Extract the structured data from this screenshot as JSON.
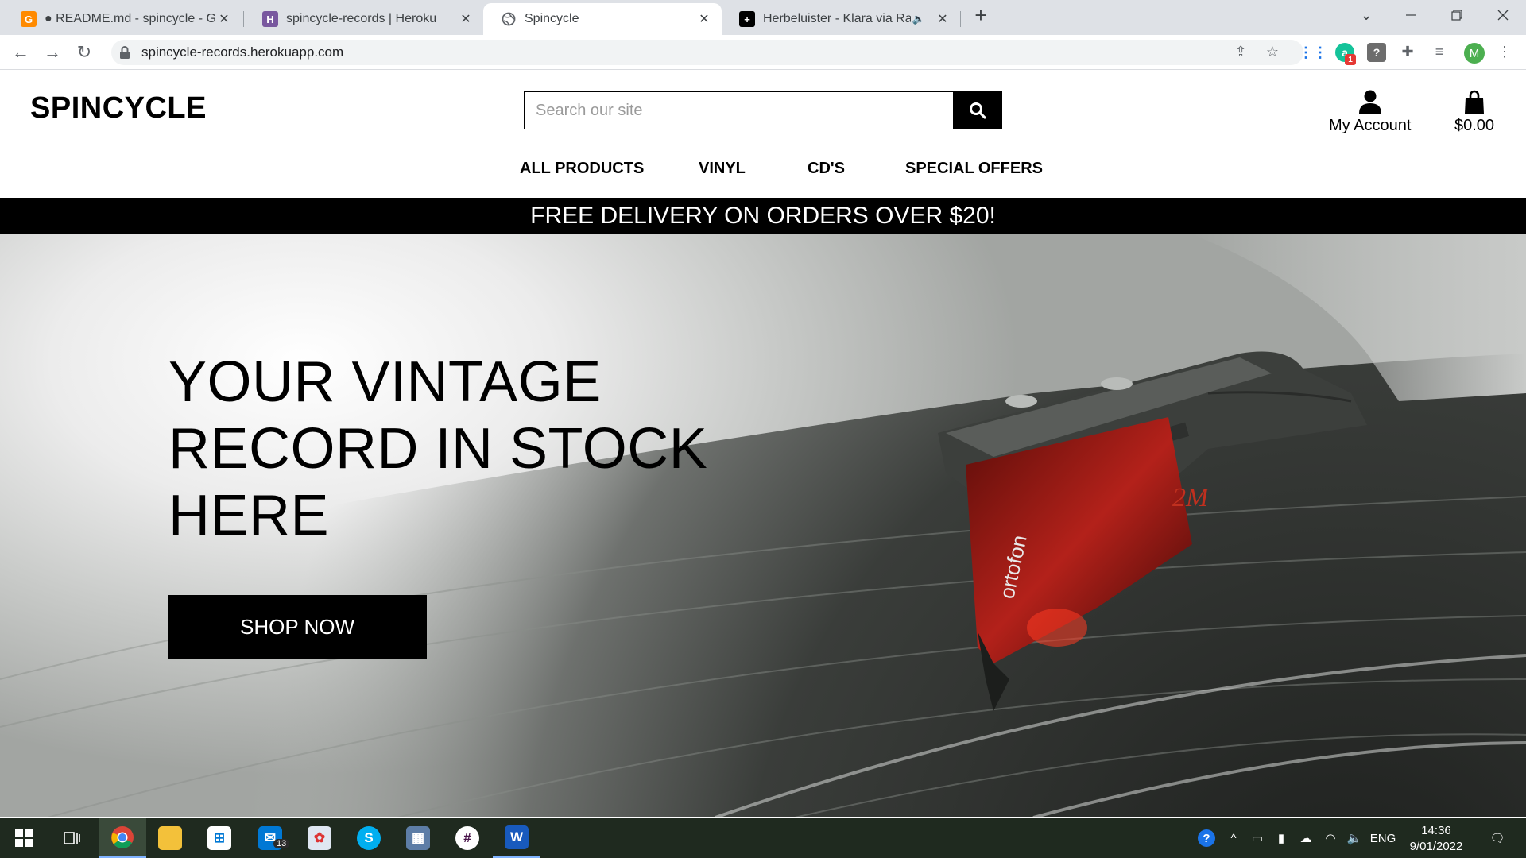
{
  "browser": {
    "tabs": [
      {
        "title": "● README.md - spincycle - Gitpo",
        "favicon": "gitpod-icon",
        "color": "#ff8a00",
        "active": false
      },
      {
        "title": "spincycle-records | Heroku",
        "favicon": "heroku-icon",
        "color": "#79589f",
        "active": false
      },
      {
        "title": "Spincycle",
        "favicon": "globe-icon",
        "color": "#5f6368",
        "active": true
      },
      {
        "title": "Herbeluister - Klara via Radio",
        "favicon": "plus-square-icon",
        "color": "#000000",
        "active": false
      }
    ],
    "new_tab_label": "+",
    "url": "spincycle-records.herokuapp.com",
    "profile_initial": "M",
    "extension_badge": "1"
  },
  "site": {
    "brand": "SPINCYCLE",
    "search_placeholder": "Search our site",
    "account_label": "My Account",
    "cart_total": "$0.00",
    "nav": [
      "ALL PRODUCTS",
      "VINYL",
      "CD'S",
      "SPECIAL OFFERS"
    ],
    "promo": "FREE DELIVERY ON ORDERS OVER $20!",
    "hero": {
      "title_lines": [
        "YOUR VINTAGE",
        "RECORD IN STOCK",
        "HERE"
      ],
      "button": "SHOP NOW",
      "cartridge_brand": "ortofon"
    }
  },
  "taskbar": {
    "mail_badge": "13",
    "language": "ENG",
    "time": "14:36",
    "date": "9/01/2022"
  },
  "colors": {
    "brand_text": "#000000",
    "promo_bg": "#000000",
    "button_bg": "#000000",
    "cartridge_red": "#b3211a"
  }
}
